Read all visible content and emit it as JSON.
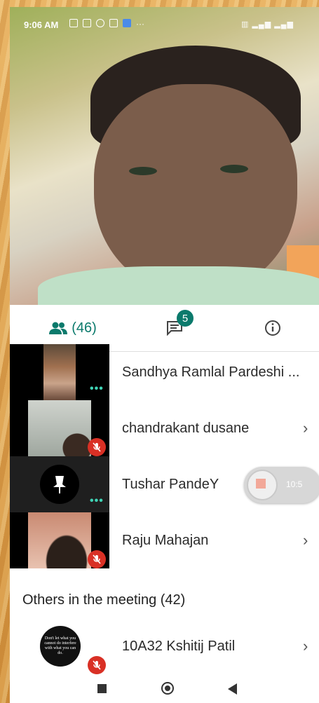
{
  "status_bar": {
    "time": "9:06 AM",
    "more": "···"
  },
  "tabs": {
    "people_count": "(46)",
    "chat_badge": "5"
  },
  "participants": [
    {
      "name": "Sandhya Ramlal Pardeshi ...",
      "muted": false
    },
    {
      "name": "chandrakant dusane",
      "muted": true
    },
    {
      "name": "Tushar PandeY",
      "muted": false,
      "pinned": true
    },
    {
      "name": "Raju Mahajan",
      "muted": true
    }
  ],
  "others": {
    "title": "Others in the meeting (42)",
    "participants": [
      {
        "name": "10A32 Kshitij Patil",
        "muted": true,
        "thumb_text": "Don't let what you cannot do interfere with what you can do."
      }
    ]
  },
  "recording": {
    "time": "10:5"
  },
  "colors": {
    "accent": "#0b7a6c",
    "muted_red": "#d93025",
    "dots": "#3fd3b5"
  }
}
